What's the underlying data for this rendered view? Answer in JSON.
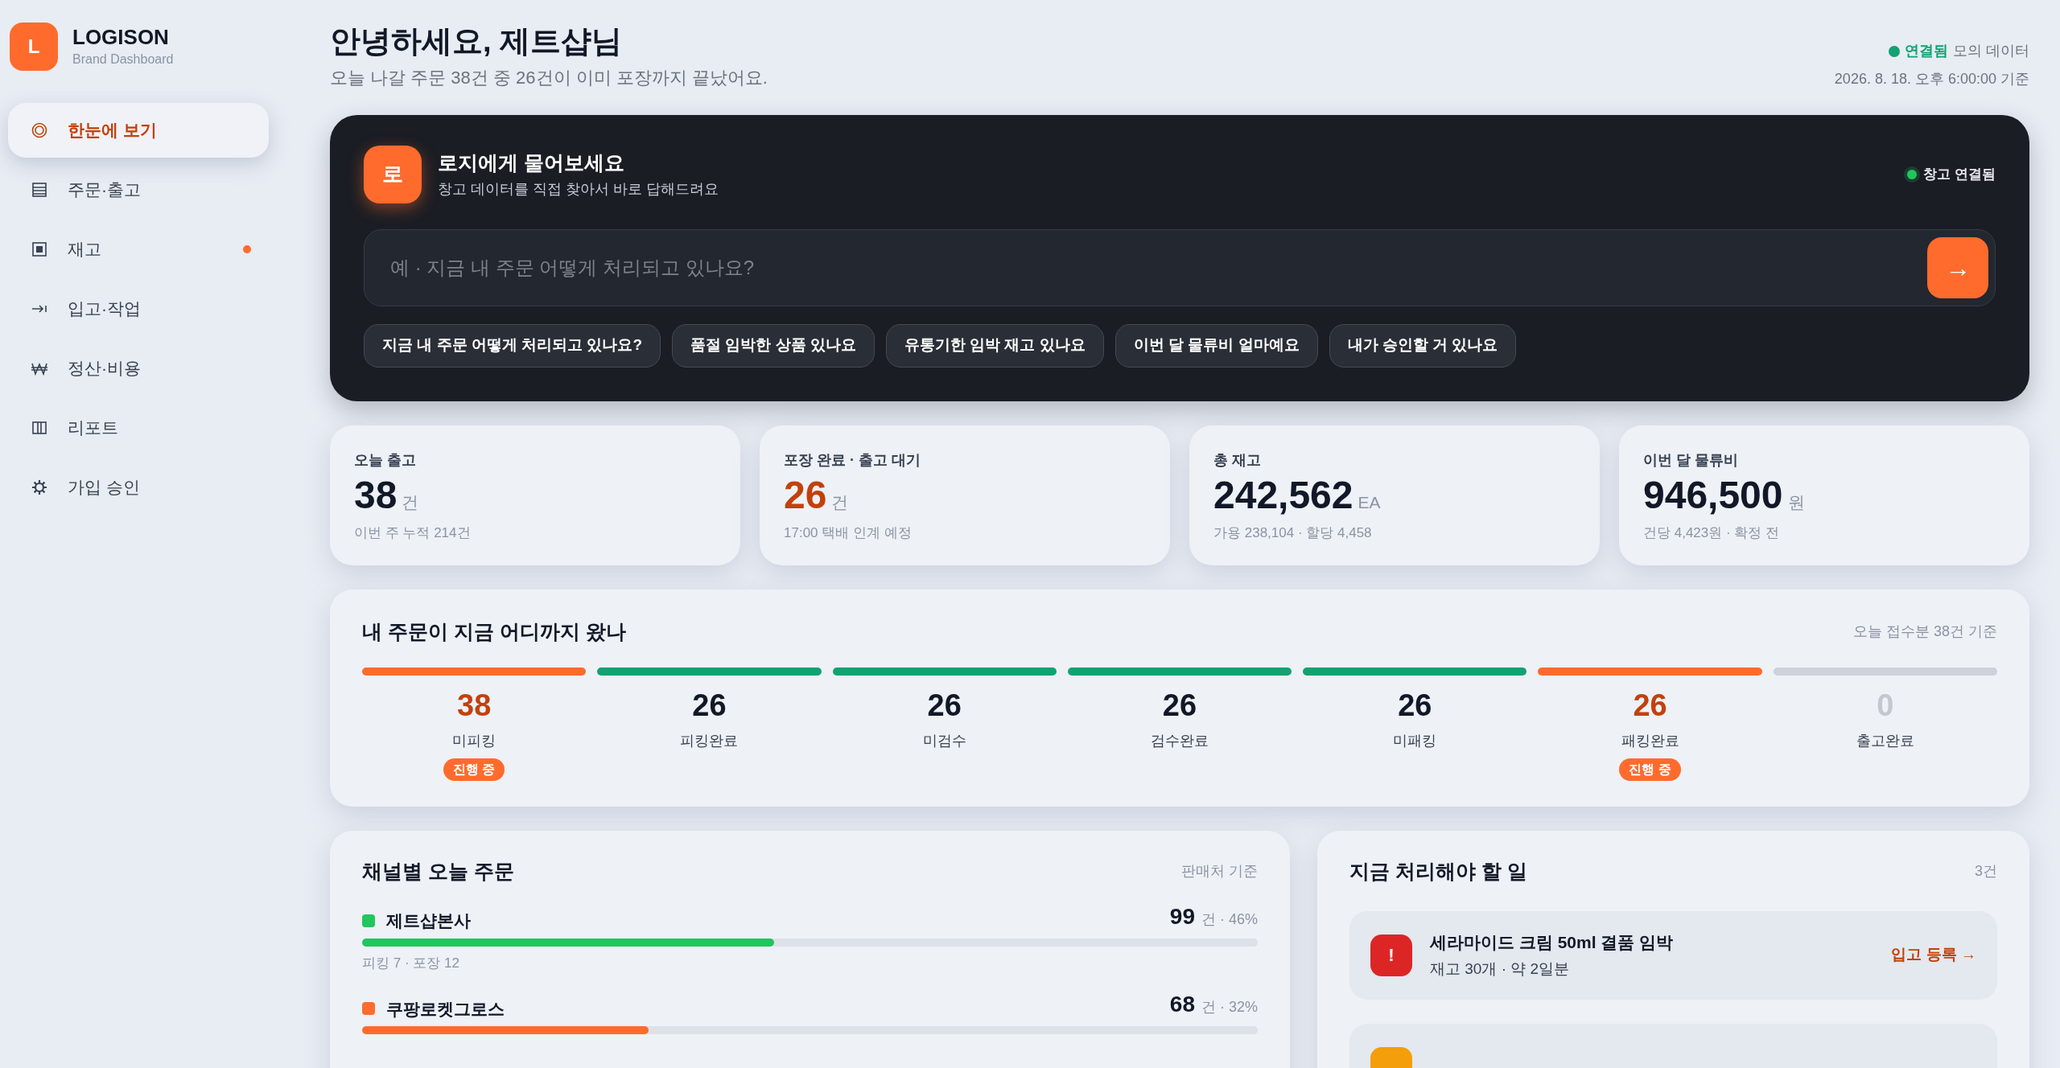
{
  "brand": {
    "logo_letter": "L",
    "name": "LOGISON",
    "subtitle": "Brand Dashboard"
  },
  "sidebar": {
    "items": [
      {
        "label": "한눈에 보기",
        "selected": true,
        "alert": false
      },
      {
        "label": "주문·출고",
        "selected": false,
        "alert": false
      },
      {
        "label": "재고",
        "selected": false,
        "alert": true
      },
      {
        "label": "입고·작업",
        "selected": false,
        "alert": false
      },
      {
        "label": "정산·비용",
        "selected": false,
        "alert": false
      },
      {
        "label": "리포트",
        "selected": false,
        "alert": false
      },
      {
        "label": "가입 승인",
        "selected": false,
        "alert": false
      }
    ]
  },
  "header": {
    "title": "안녕하세요, 제트샵님",
    "subtitle": "오늘 나갈 주문 38건 중 26건이 이미 포장까지 끝났어요.",
    "status": {
      "connected": true,
      "label": "연결됨",
      "note": "모의 데이터"
    },
    "timestamp": "2026. 8. 18. 오후 6:00:00 기준"
  },
  "assistant": {
    "avatar": "로",
    "title": "로지에게 물어보세요",
    "subtitle": "창고 데이터를 직접 찾아서 바로 답해드려요",
    "status": {
      "connected": true,
      "label": "창고 연결됨"
    },
    "input": {
      "placeholder": "예 · 지금 내 주문 어떻게 처리되고 있나요?"
    },
    "send": "→",
    "suggestions": [
      "지금 내 주문 어떻게 처리되고 있나요?",
      "품절 임박한 상품 있나요",
      "유통기한 임박 재고 있나요",
      "이번 달 물류비 얼마예요",
      "내가 승인할 거 있나요"
    ]
  },
  "kpis": [
    {
      "label": "오늘 출고",
      "value": "38",
      "unit": "건",
      "note": "이번 주 누적 214건",
      "highlight": false
    },
    {
      "label": "포장 완료 · 출고 대기",
      "value": "26",
      "unit": "건",
      "note": "17:00 택배 인계 예정",
      "highlight": true
    },
    {
      "label": "총 재고",
      "value": "242,562",
      "unit": "EA",
      "note": "가용 238,104 · 할당 4,458",
      "highlight": false
    },
    {
      "label": "이번 달 물류비",
      "value": "946,500",
      "unit": "원",
      "note": "건당 4,423원 · 확정 전",
      "highlight": false
    }
  ],
  "pipeline": {
    "title": "내 주문이 지금 어디까지 왔나",
    "note": "오늘 접수분 38건 기준",
    "stages": [
      {
        "value": "38",
        "label": "미피킹",
        "kind": "active",
        "badge": "진행 중"
      },
      {
        "value": "26",
        "label": "피킹완료",
        "kind": "done"
      },
      {
        "value": "26",
        "label": "미검수",
        "kind": "done"
      },
      {
        "value": "26",
        "label": "검수완료",
        "kind": "done"
      },
      {
        "value": "26",
        "label": "미패킹",
        "kind": "done"
      },
      {
        "value": "26",
        "label": "패킹완료",
        "kind": "active",
        "badge": "진행 중"
      },
      {
        "value": "0",
        "label": "출고완료",
        "kind": "pending"
      }
    ]
  },
  "channels": {
    "title": "채널별 오늘 주문",
    "note": "판매처 기준",
    "items": [
      {
        "name": "제트샵본사",
        "color": "#22c55e",
        "value": "99",
        "unit": "건 · 46%",
        "level": 0.46,
        "detail": "피킹 7 · 포장 12"
      },
      {
        "name": "쿠팡로켓그로스",
        "color": "#ff6b2c",
        "value": "68",
        "unit": "건 · 32%",
        "level": 0.32
      }
    ]
  },
  "tasks": {
    "title": "지금 처리해야 할 일",
    "count": "3건",
    "items": [
      {
        "kind": "danger",
        "icon": "!",
        "title": "세라마이드 크림 50ml 결품 임박",
        "detail": "재고 30개 · 약 2일분",
        "action": "입고 등록 →"
      },
      {
        "kind": "warning"
      }
    ]
  }
}
